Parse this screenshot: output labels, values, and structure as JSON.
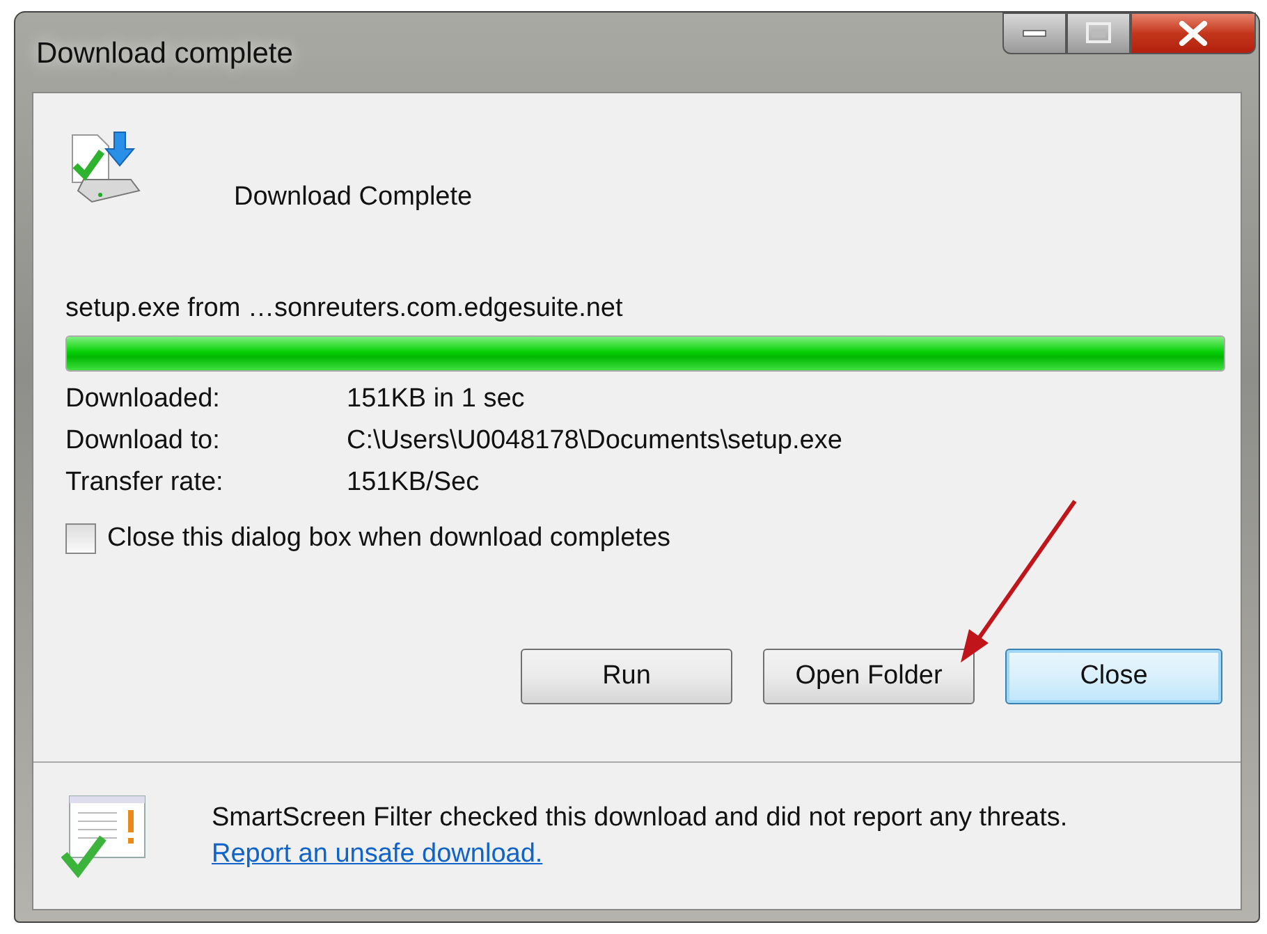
{
  "window": {
    "title": "Download complete"
  },
  "header": {
    "heading": "Download Complete"
  },
  "download": {
    "source": "setup.exe from …sonreuters.com.edgesuite.net",
    "progress": {
      "level": 1.0
    }
  },
  "details": [
    {
      "label": "Downloaded:",
      "value": "151KB in 1 sec"
    },
    {
      "label": "Download to:",
      "value": "C:\\Users\\U0048178\\Documents\\setup.exe"
    },
    {
      "label": "Transfer rate:",
      "value": "151KB/Sec"
    }
  ],
  "close_when_done": {
    "label": "Close this dialog box when download completes",
    "checked": false
  },
  "buttons": [
    {
      "label": "Run",
      "default": false
    },
    {
      "label": "Open Folder",
      "default": false
    },
    {
      "label": "Close",
      "default": true
    }
  ],
  "footer": {
    "message": "SmartScreen Filter checked this download and did not report any threats.",
    "link": "Report an unsafe download."
  }
}
